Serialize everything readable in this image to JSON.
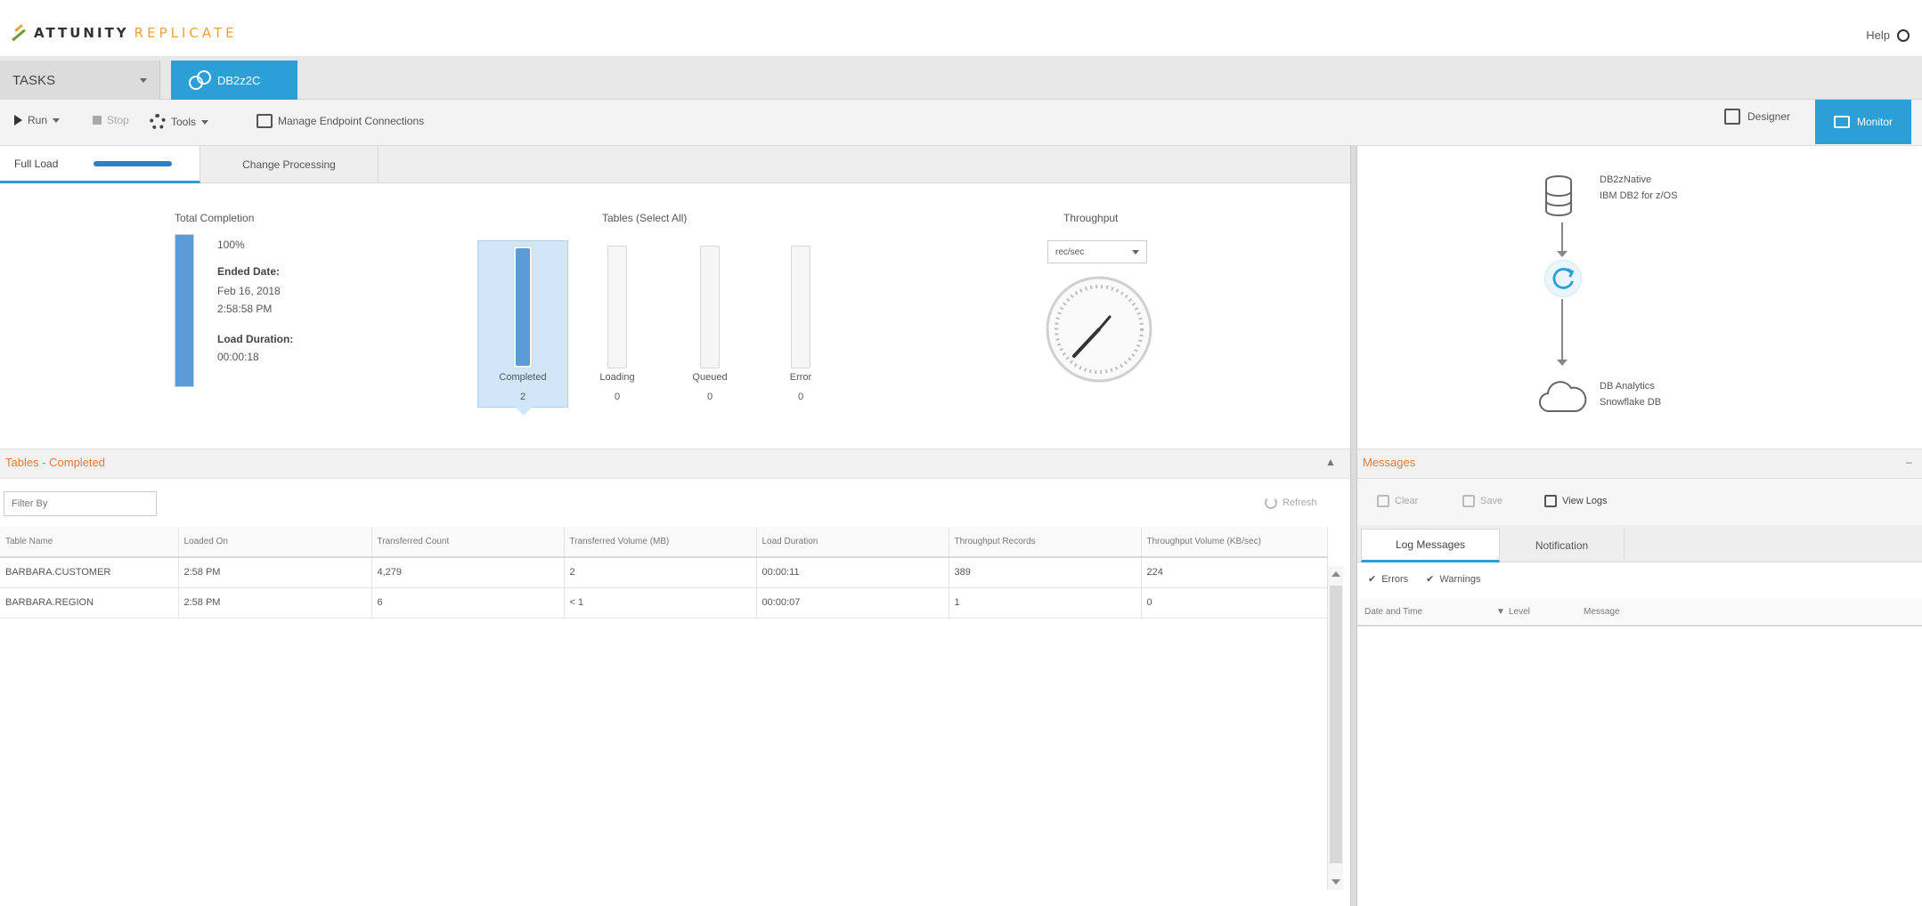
{
  "app": {
    "brand_primary": "ATTUNITY",
    "brand_secondary": "REPLICATE",
    "help_label": "Help"
  },
  "nav": {
    "tasks_selector": "TASKS",
    "task_tab": "DB2z2C"
  },
  "toolbar": {
    "run": "Run",
    "stop": "Stop",
    "tools": "Tools",
    "manage_endpoints": "Manage Endpoint Connections",
    "designer": "Designer",
    "monitor": "Monitor"
  },
  "subtabs": {
    "full_load": "Full Load",
    "change_processing": "Change Processing"
  },
  "total_completion": {
    "title": "Total Completion",
    "percent_label": "100%",
    "percent_value": 100,
    "ended_label": "Ended Date:",
    "ended_date": "Feb 16, 2018",
    "ended_time": "2:58:58 PM",
    "duration_label": "Load Duration:",
    "duration": "00:00:18"
  },
  "tables_status": {
    "title": "Tables (Select All)",
    "bars": [
      {
        "label": "Completed",
        "count": "2",
        "fraction": 1.0,
        "selected": true
      },
      {
        "label": "Loading",
        "count": "0",
        "fraction": 0.0,
        "selected": false
      },
      {
        "label": "Queued",
        "count": "0",
        "fraction": 0.0,
        "selected": false
      },
      {
        "label": "Error",
        "count": "0",
        "fraction": 0.0,
        "selected": false
      }
    ]
  },
  "throughput": {
    "title": "Throughput",
    "unit": "rec/sec"
  },
  "completed_section": {
    "title": "Tables - Completed",
    "filter_placeholder": "Filter By",
    "refresh": "Refresh",
    "columns": [
      "Table Name",
      "Loaded On",
      "Transferred Count",
      "Transferred Volume (MB)",
      "Load Duration",
      "Throughput Records",
      "Throughput Volume (KB/sec)"
    ],
    "rows": [
      [
        "BARBARA.CUSTOMER",
        "2:58 PM",
        "4,279",
        "2",
        "00:00:11",
        "389",
        "224"
      ],
      [
        "BARBARA.REGION",
        "2:58 PM",
        "6",
        "< 1",
        "00:00:07",
        "1",
        "0"
      ]
    ]
  },
  "diagram": {
    "source_name": "DB2zNative",
    "source_type": "IBM DB2 for z/OS",
    "target_name": "DB Analytics",
    "target_type": "Snowflake DB"
  },
  "messages": {
    "title": "Messages",
    "clear": "Clear",
    "save": "Save",
    "view_logs": "View Logs",
    "tab_log": "Log Messages",
    "tab_notifications": "Notification",
    "filter_errors": "Errors",
    "filter_warnings": "Warnings",
    "col_date": "Date and Time",
    "col_level": "Level",
    "col_message": "Message"
  },
  "colors": {
    "accent": "#2b9fd6",
    "bar_fill": "#5b9bd8",
    "section_title": "#e07a3a"
  }
}
